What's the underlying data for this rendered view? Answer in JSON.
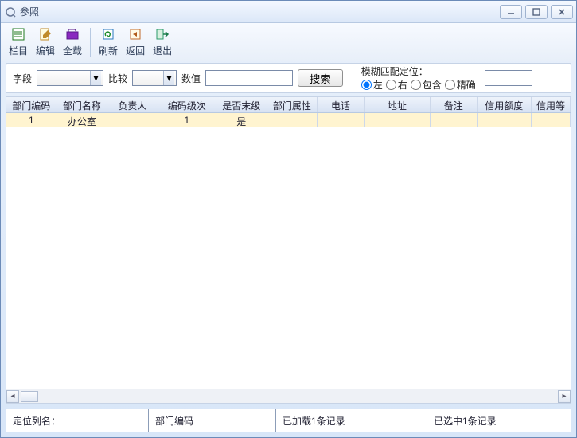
{
  "window": {
    "title": "参照"
  },
  "toolbar": {
    "items": [
      {
        "label": "栏目",
        "icon": "list-icon",
        "color": "#1f7a1f"
      },
      {
        "label": "编辑",
        "icon": "edit-icon",
        "color": "#c08a2a"
      },
      {
        "label": "全载",
        "icon": "loadall-icon",
        "color": "#8a2ac0"
      },
      {
        "_sep": true
      },
      {
        "label": "刷新",
        "icon": "refresh-icon",
        "color": "#2a7ac0"
      },
      {
        "label": "返回",
        "icon": "back-icon",
        "color": "#c06a2a"
      },
      {
        "label": "退出",
        "icon": "exit-icon",
        "color": "#2a9a6a"
      }
    ]
  },
  "search": {
    "field_label": "字段",
    "compare_label": "比较",
    "value_label": "数值",
    "search_btn": "搜索",
    "fuzzy_legend": "模糊匹配定位：",
    "radios": {
      "left": "左",
      "right": "右",
      "contains": "包含",
      "exact": "精确"
    },
    "selected_radio": "left"
  },
  "table": {
    "columns": [
      "部门编码",
      "部门名称",
      "负责人",
      "编码级次",
      "是否末级",
      "部门属性",
      "电话",
      "地址",
      "备注",
      "信用额度",
      "信用等"
    ],
    "rows": [
      {
        "cells": [
          "1",
          "办公室",
          "",
          "1",
          "是",
          "",
          "",
          "",
          "",
          "",
          ""
        ]
      }
    ]
  },
  "status": {
    "locate_label": "定位列名：",
    "column": "部门编码",
    "loaded": "已加载1条记录",
    "selected": "已选中1条记录"
  }
}
